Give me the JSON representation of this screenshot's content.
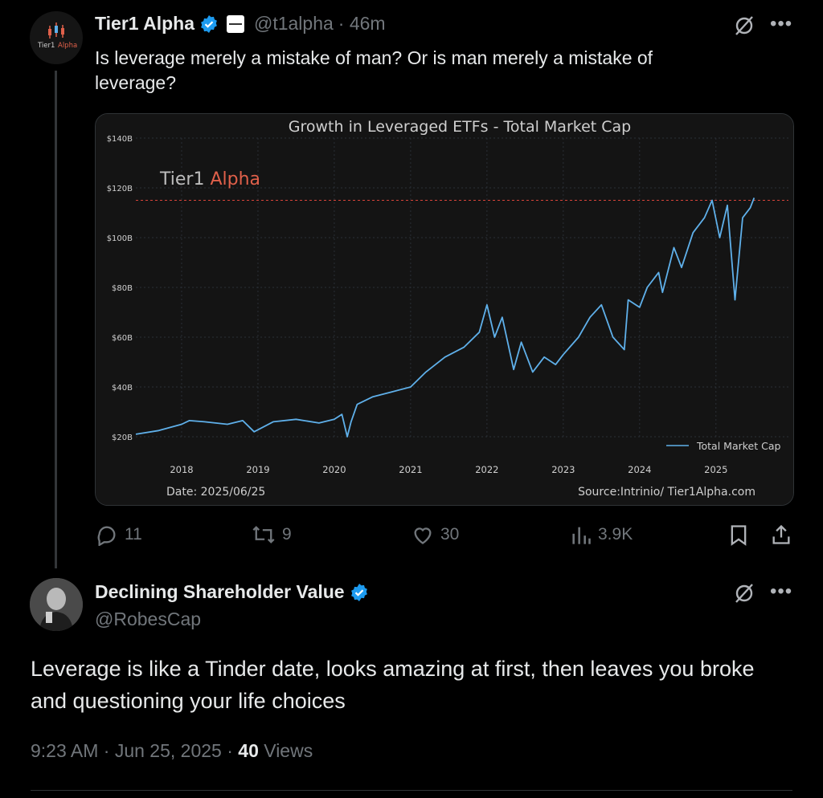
{
  "tweet": {
    "author": {
      "name": "Tier1 Alpha",
      "handle": "@t1alpha",
      "time": "· 46m",
      "logo_text_1": "Tier1",
      "logo_text_2": "Alpha"
    },
    "text": "Is leverage merely a mistake of man? Or is man merely a mistake of leverage?",
    "actions": {
      "replies": "11",
      "reposts": "9",
      "likes": "30",
      "views": "3.9K"
    }
  },
  "reply": {
    "author": {
      "name": "Declining Shareholder Value",
      "handle": "@RobesCap"
    },
    "text": "Leverage is like a Tinder date, looks amazing at first, then leaves you broke and questioning your life choices",
    "meta": {
      "time": "9:23 AM · Jun 25, 2025 · ",
      "views_count": "40",
      "views_label": " Views"
    }
  },
  "chart_data": {
    "type": "line",
    "title": "Growth in Leveraged ETFs - Total Market Cap",
    "watermark": [
      "Tier1 ",
      "Alpha"
    ],
    "date_note": "Date: 2025/06/25",
    "source": "Source:Intrinio/ Tier1Alpha.com",
    "ylim": [
      20,
      140
    ],
    "xlim": [
      2017.4,
      2025.95
    ],
    "y_ticks": [
      "$20B",
      "$40B",
      "$60B",
      "$80B",
      "$100B",
      "$120B",
      "$140B"
    ],
    "y_tick_values": [
      20,
      40,
      60,
      80,
      100,
      120,
      140
    ],
    "x_ticks": [
      "2018",
      "2019",
      "2020",
      "2021",
      "2022",
      "2023",
      "2024",
      "2025"
    ],
    "x_tick_values": [
      2018,
      2019,
      2020,
      2021,
      2022,
      2023,
      2024,
      2025
    ],
    "reference_line": 115,
    "series": [
      {
        "name": "Total Market Cap",
        "x": [
          2017.4,
          2017.7,
          2018.0,
          2018.1,
          2018.3,
          2018.6,
          2018.8,
          2018.95,
          2019.2,
          2019.5,
          2019.8,
          2020.0,
          2020.1,
          2020.17,
          2020.22,
          2020.3,
          2020.5,
          2020.75,
          2021.0,
          2021.2,
          2021.45,
          2021.7,
          2021.9,
          2022.0,
          2022.1,
          2022.2,
          2022.35,
          2022.45,
          2022.6,
          2022.75,
          2022.9,
          2023.0,
          2023.2,
          2023.35,
          2023.5,
          2023.65,
          2023.8,
          2023.85,
          2024.0,
          2024.1,
          2024.25,
          2024.3,
          2024.45,
          2024.55,
          2024.7,
          2024.85,
          2024.95,
          2025.05,
          2025.15,
          2025.25,
          2025.35,
          2025.45,
          2025.5
        ],
        "values": [
          21,
          22.5,
          25,
          26.5,
          26,
          25,
          26.5,
          22,
          26,
          27,
          25.5,
          27,
          29,
          20,
          26,
          33,
          36,
          38,
          40,
          46,
          52,
          56,
          62,
          73,
          60,
          68,
          47,
          58,
          46,
          52,
          49,
          53,
          60,
          68,
          73,
          60,
          55,
          75,
          72,
          80,
          86,
          78,
          96,
          88,
          102,
          108,
          115,
          100,
          113,
          75,
          108,
          112,
          116
        ]
      }
    ]
  }
}
